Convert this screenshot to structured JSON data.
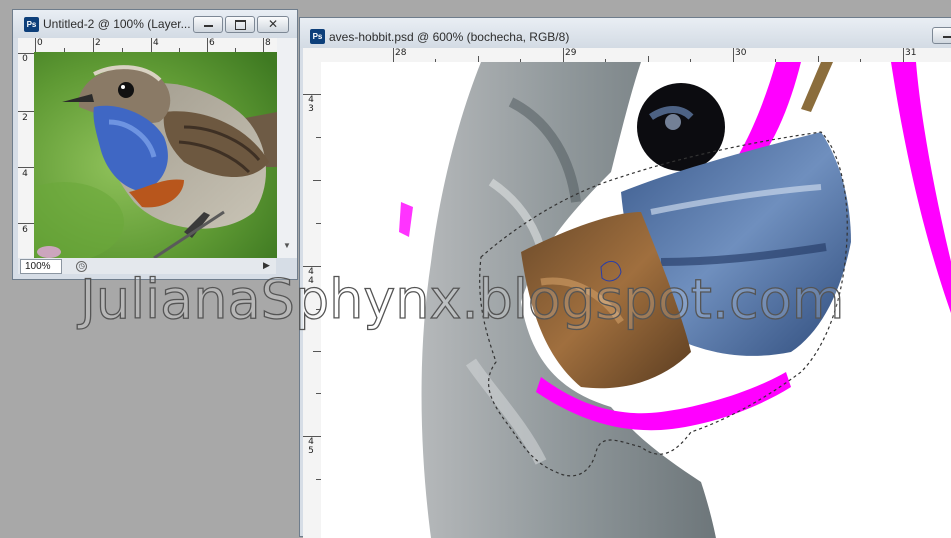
{
  "small_window": {
    "title": "Untitled-2 @ 100% (Layer...",
    "app_badge": "Ps",
    "ruler_top": [
      "0",
      "2",
      "4",
      "6",
      "8"
    ],
    "ruler_left": [
      "0",
      "2",
      "4",
      "6"
    ],
    "zoom": "100%"
  },
  "main_window": {
    "title": "aves-hobbit.psd @ 600% (bochecha, RGB/8)",
    "app_badge": "Ps",
    "ruler_top": [
      "28",
      "29",
      "30",
      "31"
    ],
    "ruler_left": [
      {
        "digits": [
          "4",
          "3"
        ]
      },
      {
        "digits": [
          "4",
          "4"
        ]
      },
      {
        "digits": [
          "4",
          "5"
        ]
      }
    ]
  },
  "watermark": "JulianaSphynx.blogspot.com",
  "colors": {
    "accent_magenta": "#ff00ff",
    "selection_outline": "#333333",
    "ps_blue": "#0d3f7a"
  },
  "icons": {
    "minimize": "minimize-icon",
    "maximize": "maximize-icon",
    "close": "close-icon"
  }
}
